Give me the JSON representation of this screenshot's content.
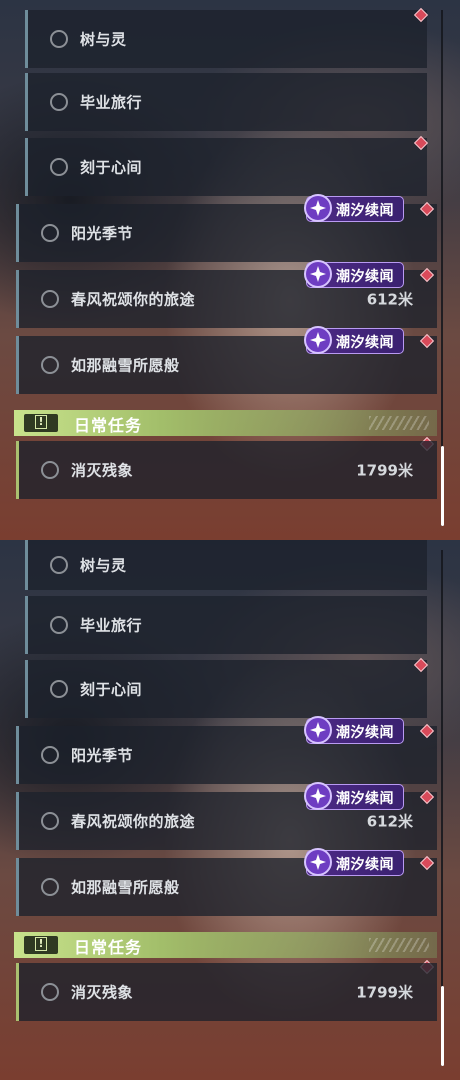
{
  "panels": [
    {
      "quests": [
        {
          "label": "树与灵"
        },
        {
          "label": "毕业旅行"
        },
        {
          "label": "刻于心间"
        },
        {
          "label": "阳光季节",
          "badge": "潮汐续闻"
        },
        {
          "label": "春风祝颂你的旅途",
          "badge": "潮汐续闻",
          "distance": "612米"
        },
        {
          "label": "如那融雪所愿般",
          "badge": "潮汐续闻"
        }
      ],
      "section": {
        "title": "日常任务",
        "icon": "exclamation-box-icon"
      },
      "daily": [
        {
          "label": "消灭残象",
          "distance": "1799米"
        }
      ]
    },
    {
      "quests": [
        {
          "label": "树与灵"
        },
        {
          "label": "毕业旅行"
        },
        {
          "label": "刻于心间"
        },
        {
          "label": "阳光季节",
          "badge": "潮汐续闻"
        },
        {
          "label": "春风祝颂你的旅途",
          "badge": "潮汐续闻",
          "distance": "612米"
        },
        {
          "label": "如那融雪所愿般",
          "badge": "潮汐续闻"
        }
      ],
      "section": {
        "title": "日常任务",
        "icon": "exclamation-box-icon"
      },
      "daily": [
        {
          "label": "消灭残象",
          "distance": "1799米"
        }
      ]
    }
  ],
  "colors": {
    "accent_daily": "#c8e38c",
    "badge_purple": "#4d2a86",
    "marker_red": "#d94a5a"
  }
}
